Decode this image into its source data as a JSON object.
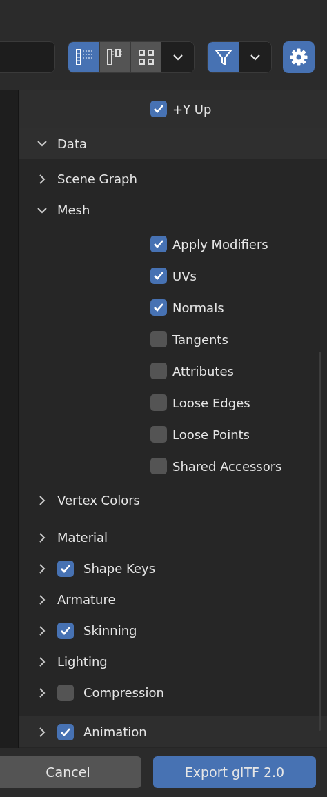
{
  "toolbar": {
    "view_modes": [
      {
        "kind": "list",
        "selected": true
      },
      {
        "kind": "columns",
        "selected": false
      },
      {
        "kind": "grid",
        "selected": false
      }
    ],
    "filter": {
      "on": true
    }
  },
  "top_options": [
    {
      "label": "+Y Up",
      "checked": true
    }
  ],
  "panels": [
    {
      "label": "Data",
      "expanded": true,
      "children": [
        {
          "kind": "plain",
          "label": "Scene Graph",
          "expanded": false
        },
        {
          "kind": "plain",
          "label": "Mesh",
          "expanded": true,
          "options": [
            {
              "label": "Apply Modifiers",
              "checked": true
            },
            {
              "label": "UVs",
              "checked": true
            },
            {
              "label": "Normals",
              "checked": true
            },
            {
              "label": "Tangents",
              "checked": false
            },
            {
              "label": "Attributes",
              "checked": false
            },
            {
              "label": "Loose Edges",
              "checked": false
            },
            {
              "label": "Loose Points",
              "checked": false
            },
            {
              "label": "Shared Accessors",
              "checked": false
            }
          ]
        },
        {
          "kind": "plain",
          "label": "Vertex Colors",
          "expanded": false
        },
        {
          "kind": "plain",
          "label": "Material",
          "expanded": false
        },
        {
          "kind": "toggle",
          "label": "Shape Keys",
          "expanded": false,
          "checked": true
        },
        {
          "kind": "plain",
          "label": "Armature",
          "expanded": false
        },
        {
          "kind": "toggle",
          "label": "Skinning",
          "expanded": false,
          "checked": true
        },
        {
          "kind": "plain",
          "label": "Lighting",
          "expanded": false
        },
        {
          "kind": "toggle",
          "label": "Compression",
          "expanded": false,
          "checked": false
        }
      ]
    },
    {
      "label": "Animation",
      "expanded": false,
      "checked": true
    }
  ],
  "buttons": [
    {
      "kind": "secondary",
      "label": "Cancel"
    },
    {
      "kind": "primary",
      "label": "Export glTF 2.0"
    }
  ]
}
